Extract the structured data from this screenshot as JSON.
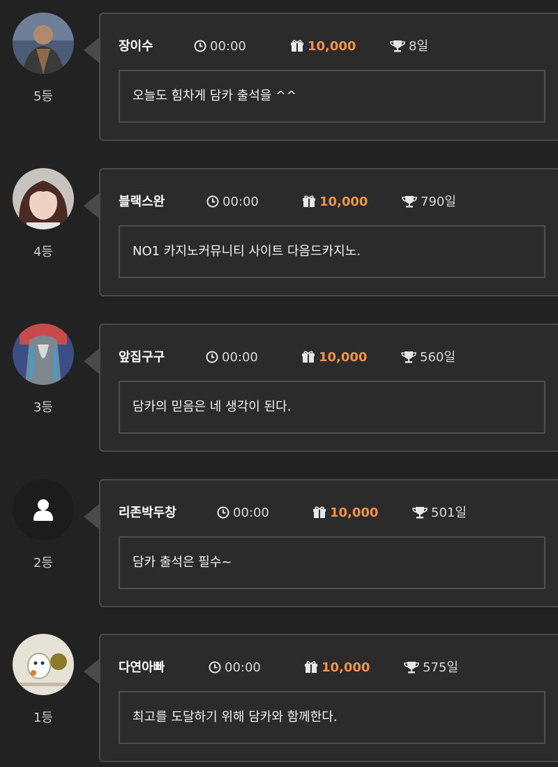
{
  "entries": [
    {
      "rank_label": "5등",
      "avatar": "photo-avatar",
      "name": "장이수",
      "time": "00:00",
      "points": "10,000",
      "days": "8일",
      "message": "오늘도 힘차게 담카 출석을 ^^"
    },
    {
      "rank_label": "4등",
      "avatar": "photo-avatar",
      "name": "블랙스완",
      "time": "00:00",
      "points": "10,000",
      "days": "790일",
      "message": "NO1 카지노커뮤니티 사이트 다음드카지노."
    },
    {
      "rank_label": "3등",
      "avatar": "photo-avatar",
      "name": "앞집구구",
      "time": "00:00",
      "points": "10,000",
      "days": "560일",
      "message": "담카의 믿음은 네 생각이 된다."
    },
    {
      "rank_label": "2등",
      "avatar": "default-user-icon",
      "name": "리존박두창",
      "time": "00:00",
      "points": "10,000",
      "days": "501일",
      "message": "담카 출석은 필수~"
    },
    {
      "rank_label": "1등",
      "avatar": "photo-avatar",
      "name": "다연아빠",
      "time": "00:00",
      "points": "10,000",
      "days": "575일",
      "message": "최고를 도달하기 위해 담카와 함께한다."
    }
  ],
  "icons": {
    "time": "clock-icon",
    "points": "gift-icon",
    "days": "trophy-icon"
  },
  "colors": {
    "background": "#222222",
    "card_border": "#4a4a4a",
    "points": "#f0924c"
  }
}
